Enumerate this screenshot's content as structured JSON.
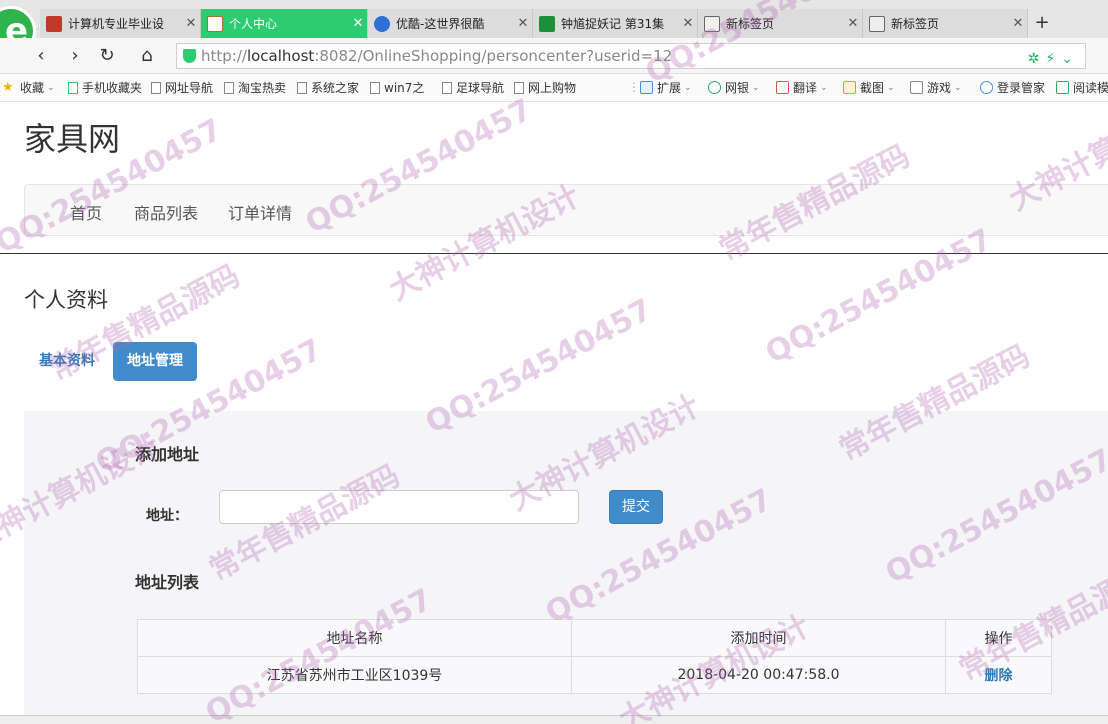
{
  "browser": {
    "tabs": [
      {
        "label": "计算机专业毕业设",
        "active": false
      },
      {
        "label": "个人中心",
        "active": true
      },
      {
        "label": "优酷-这世界很酷",
        "active": false
      },
      {
        "label": "钟馗捉妖记 第31集",
        "active": false
      },
      {
        "label": "新标签页",
        "active": false
      },
      {
        "label": "新标签页",
        "active": false
      }
    ],
    "new_tab": "+",
    "close_glyph": "✕",
    "url": {
      "scheme": "http://",
      "host": "localhost",
      "rest": ":8082/OnlineShopping/personcenter?userid=12"
    },
    "bookmarks": [
      {
        "label": "收藏"
      },
      {
        "label": "手机收藏夹"
      },
      {
        "label": "网址导航"
      },
      {
        "label": "淘宝热卖"
      },
      {
        "label": "系统之家"
      },
      {
        "label": "win7之"
      },
      {
        "label": "足球导航"
      },
      {
        "label": "网上购物"
      },
      {
        "label": "扩展"
      },
      {
        "label": "网银"
      },
      {
        "label": "翻译"
      },
      {
        "label": "截图"
      },
      {
        "label": "游戏"
      },
      {
        "label": "登录管家"
      },
      {
        "label": "阅读模"
      }
    ]
  },
  "site": {
    "title": "家具网",
    "nav": [
      "首页",
      "商品列表",
      "订单详情"
    ]
  },
  "profile": {
    "title": "个人资料",
    "tabs": [
      {
        "label": "基本资料",
        "active": false
      },
      {
        "label": "地址管理",
        "active": true
      }
    ]
  },
  "address": {
    "add_title": "添加地址",
    "field_label": "地址：",
    "field_value": "",
    "submit": "提交",
    "list_title": "地址列表",
    "columns": [
      "地址名称",
      "添加时间",
      "操作"
    ],
    "rows": [
      {
        "name": "江苏省苏州市工业区1039号",
        "time": "2018-04-20 00:47:58.0",
        "action": "删除"
      }
    ]
  },
  "watermark": {
    "texts": [
      "QQ:254540457",
      "常年售精品源码",
      "大神计算机设计"
    ]
  },
  "colors": {
    "active_tab": "#2ecc71",
    "primary": "#428bca",
    "link": "#337ab7"
  }
}
